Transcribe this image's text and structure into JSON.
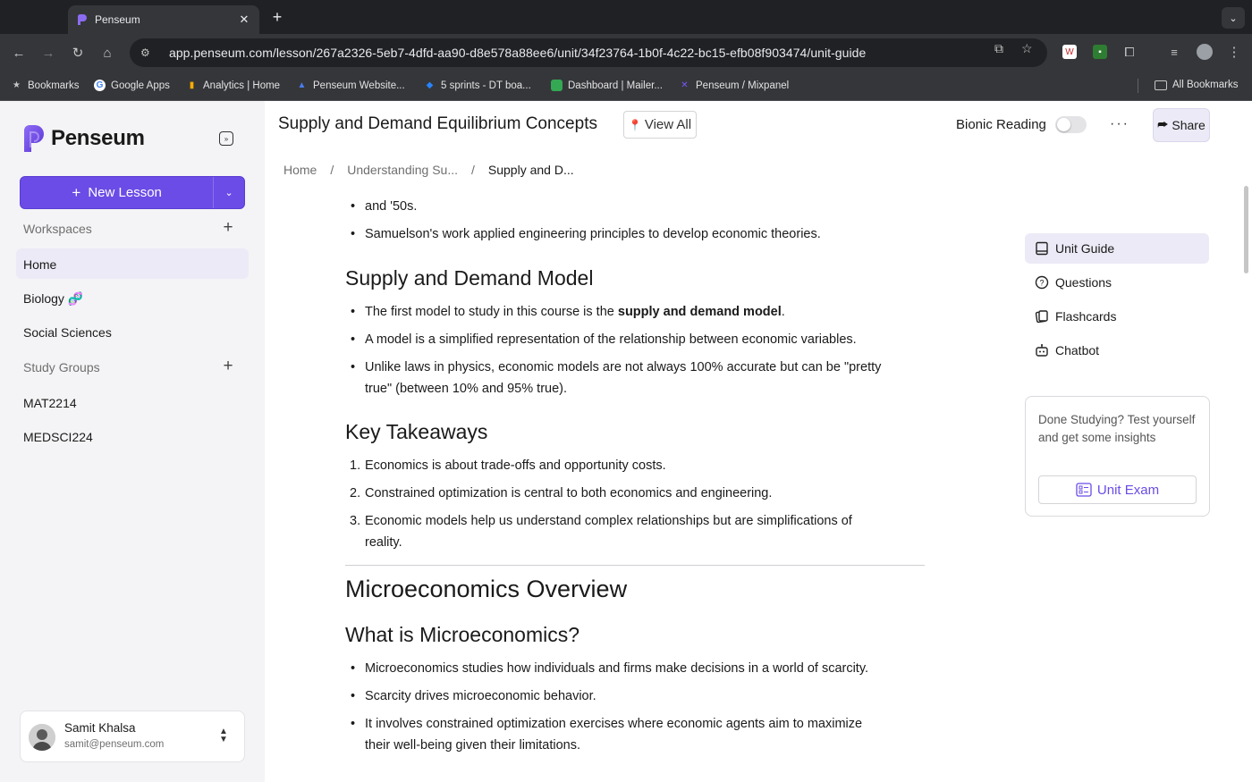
{
  "browser": {
    "tab_title": "Penseum",
    "url": "app.penseum.com/lesson/267a2326-5eb7-4dfd-aa90-d8e578a88ee6/unit/34f23764-1b0f-4c22-bc15-efb08f903474/unit-guide",
    "bookmarks": [
      {
        "label": "Bookmarks",
        "icon": "star-icon"
      },
      {
        "label": "Google Apps",
        "icon": "google-icon"
      },
      {
        "label": "Analytics | Home",
        "icon": "analytics-icon"
      },
      {
        "label": "Penseum Website...",
        "icon": "penseum-website-icon"
      },
      {
        "label": "5 sprints - DT boa...",
        "icon": "jira-icon"
      },
      {
        "label": "Dashboard | Mailer...",
        "icon": "mailer-icon"
      },
      {
        "label": "Penseum / Mixpanel",
        "icon": "mixpanel-icon"
      }
    ],
    "all_bookmarks": "All Bookmarks"
  },
  "sidebar": {
    "logo_text": "Penseum",
    "new_lesson": "New Lesson",
    "workspaces_label": "Workspaces",
    "workspaces": [
      "Home",
      "Biology 🧬",
      "Social Sciences"
    ],
    "study_groups_label": "Study Groups",
    "study_groups": [
      "MAT2214",
      "MEDSCI224"
    ],
    "user": {
      "name": "Samit Khalsa",
      "email": "samit@penseum.com"
    }
  },
  "header": {
    "title": "Supply and Demand Equilibrium Concepts",
    "view_all": "View All",
    "bionic_reading": "Bionic Reading",
    "bionic_enabled": false,
    "more": "···",
    "share": "Share"
  },
  "breadcrumb": [
    "Home",
    "Understanding Su...",
    "Supply and D..."
  ],
  "content": {
    "intro_tail": "and '50s.",
    "intro_bullet": "Samuelson's work applied engineering principles to develop economic theories.",
    "sd_heading": "Supply and Demand Model",
    "sd_b1_pre": "The first model to study in this course is the ",
    "sd_b1_bold": "supply and demand model",
    "sd_b1_post": ".",
    "sd_b2": "A model is a simplified representation of the relationship between economic variables.",
    "sd_b3": "Unlike laws in physics, economic models are not always 100% accurate but can be \"pretty true\" (between 10% and 95% true).",
    "kt_heading": "Key Takeaways",
    "kt_items": [
      "Economics is about trade-offs and opportunity costs.",
      "Constrained optimization is central to both economics and engineering.",
      "Economic models help us understand complex relationships but are simplifications of reality."
    ],
    "micro_heading": "Microeconomics Overview",
    "what_heading": "What is Microeconomics?",
    "what_items": [
      "Microeconomics studies how individuals and firms make decisions in a world of scarcity.",
      "Scarcity drives microeconomic behavior.",
      "It involves constrained optimization exercises where economic agents aim to maximize their well-being given their limitations."
    ]
  },
  "right_panel": {
    "nav": [
      "Unit Guide",
      "Questions",
      "Flashcards",
      "Chatbot"
    ],
    "active": "Unit Guide",
    "exam_prompt": "Done Studying? Test yourself and get some insights",
    "exam_button": "Unit Exam"
  },
  "colors": {
    "accent": "#6b4ce6",
    "active_bg": "#ebeaf6",
    "sidebar_bg": "#f4f4f6"
  }
}
